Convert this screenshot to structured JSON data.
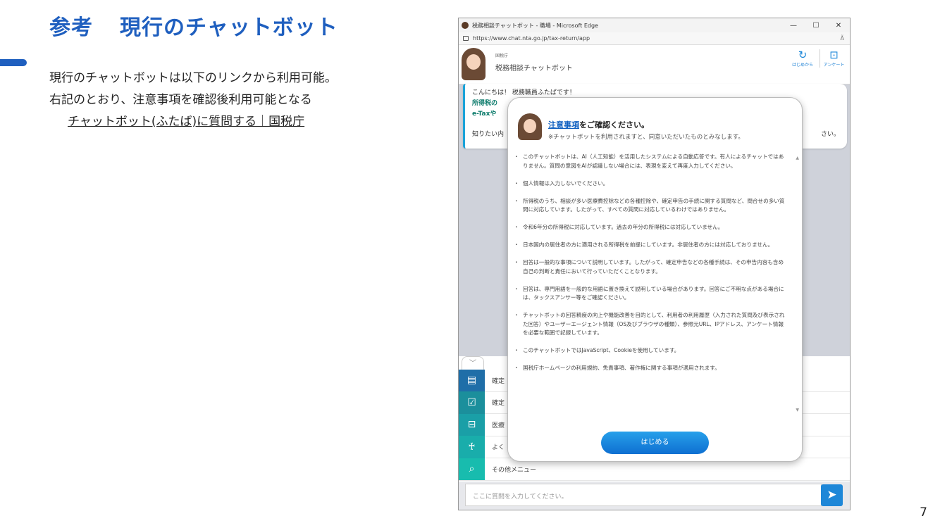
{
  "slide": {
    "title_part1": "参考",
    "title_part2": "現行のチャットボット",
    "body_line1": "現行のチャットボットは以下のリンクから利用可能。",
    "body_line2": "右記のとおり、注意事項を確認後利用可能となる",
    "body_link": "チャットボット(ふたば)に質問する｜国税庁",
    "page_number": "7",
    "accent_color": "#1f5fbf"
  },
  "browser": {
    "tab_title": "税務相談チャットボット - 職場 - Microsoft Edge",
    "url": "https://www.chat.nta.go.jp/tax-return/app",
    "minimize": "—",
    "maximize": "☐",
    "close": "✕",
    "read_aloud": "Ã"
  },
  "app": {
    "agency": "国税庁",
    "title": "税務相談チャットボット",
    "restart_label": "はじめから",
    "survey_label": "アンケート",
    "restart_icon": "restart-icon",
    "survey_icon": "survey-icon"
  },
  "chat": {
    "line1": "こんにちは！ 税務職員ふたばです！",
    "line2": "所得税の",
    "line3": "e-Taxや",
    "line4": "知りたい内",
    "line4_tail": "さい。"
  },
  "menu": {
    "toggle": "﹀",
    "items": [
      {
        "label": "確定",
        "icon": "document-icon",
        "glyph": "▤"
      },
      {
        "label": "確定",
        "icon": "checkbox-icon",
        "glyph": "☑"
      },
      {
        "label": "医療",
        "icon": "bed-icon",
        "glyph": "⊟"
      },
      {
        "label": "よく",
        "icon": "person-icon",
        "glyph": "♰"
      },
      {
        "label": "その他メニュー",
        "icon": "search-doc-icon",
        "glyph": "⌕"
      }
    ]
  },
  "input": {
    "placeholder": "ここに質問を入力してください。",
    "send_glyph": "➤"
  },
  "modal": {
    "title_highlight": "注意事項",
    "title_rest": "をご確認ください。",
    "subtitle": "※チャットボットを利用されますと、同意いただいたものとみなします。",
    "notices": [
      "このチャットボットは、AI（人工知能）を活用したシステムによる自動応答です。有人によるチャットではありません。質問の意図をAIが認識しない場合には、表現を変えて再度入力してください。",
      "個人情報は入力しないでください。",
      "所得税のうち、相談が多い医療費控除などの各種控除や、確定申告の手続に関する質問など、問合せの多い質問に対応しています。したがって、すべての質問に対応しているわけではありません。",
      "令和6年分の所得税に対応しています。過去の年分の所得税には対応していません。",
      "日本国内の居住者の方に適用される所得税を前提にしています。非居住者の方には対応しておりません。",
      "回答は一般的な事項について説明しています。したがって、確定申告などの各種手続は、その申告内容も含め自己の判断と責任において行っていただくことなります。",
      "回答は、専門用語を一般的な用語に置き換えて説明している場合があります。回答にご不明な点がある場合には、タックスアンサー等をご確認ください。",
      "チャットボットの回答精度の向上や機能改善を目的として、利用者の利用履歴（入力された質問及び表示された回答）やユーザーエージェント情報（OS及びブラウザの種類）、参照元URL、IPアドレス、アンケート情報を必要な範囲で記録しています。",
      "このチャットボットではJavaScript、Cookieを使用しています。",
      "国税庁ホームページの利用規約、免責事項、著作権に関する事項が適用されます。"
    ],
    "start_button": "はじめる"
  }
}
